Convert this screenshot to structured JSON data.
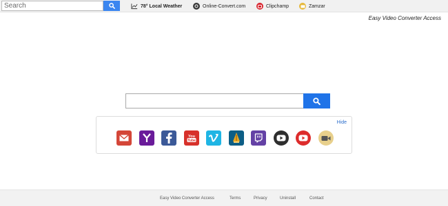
{
  "toolbar": {
    "search_placeholder": "Search",
    "items": [
      {
        "label": "78° Local Weather",
        "icon": "weather-chart-icon"
      },
      {
        "label": "Online-Convert.com",
        "icon": "online-convert-icon",
        "color": "#3a3a3a"
      },
      {
        "label": "Clipchamp",
        "icon": "clipchamp-icon",
        "color": "#d8262f"
      },
      {
        "label": "Zamzar",
        "icon": "zamzar-icon",
        "color": "#e6b83a"
      }
    ]
  },
  "brand": "Easy Video Converter Access",
  "main_search": {
    "placeholder": ""
  },
  "panel": {
    "hide_label": "Hide",
    "shortcuts": [
      {
        "name": "gmail",
        "icon": "gmail-icon",
        "color": "#d44638"
      },
      {
        "name": "yahoo",
        "icon": "yahoo-icon",
        "color": "#6a1b9a"
      },
      {
        "name": "facebook",
        "icon": "facebook-icon",
        "color": "#3b5998"
      },
      {
        "name": "youtube",
        "icon": "youtube-icon",
        "color": "#d7312b"
      },
      {
        "name": "vimeo",
        "icon": "vimeo-icon",
        "color": "#1fb5e4"
      },
      {
        "name": "video-editor",
        "icon": "video-editor-icon",
        "color": "#0d5e86"
      },
      {
        "name": "twitch",
        "icon": "twitch-icon",
        "color": "#6441a5"
      },
      {
        "name": "video-player",
        "icon": "video-player-icon",
        "color": "#2e2e2e"
      },
      {
        "name": "youtube-player",
        "icon": "youtube-player-icon",
        "color": "#dd2c2c"
      },
      {
        "name": "video-camera",
        "icon": "video-camera-icon",
        "color": "#e8d08c"
      }
    ]
  },
  "footer": {
    "links": [
      "Easy Video Converter Access",
      "Terms",
      "Privacy",
      "Uninstall",
      "Contact"
    ]
  },
  "colors": {
    "accent": "#1f73e8",
    "toolbar_bg": "#f1f1f1",
    "footer_bg": "#f2f2f2"
  }
}
